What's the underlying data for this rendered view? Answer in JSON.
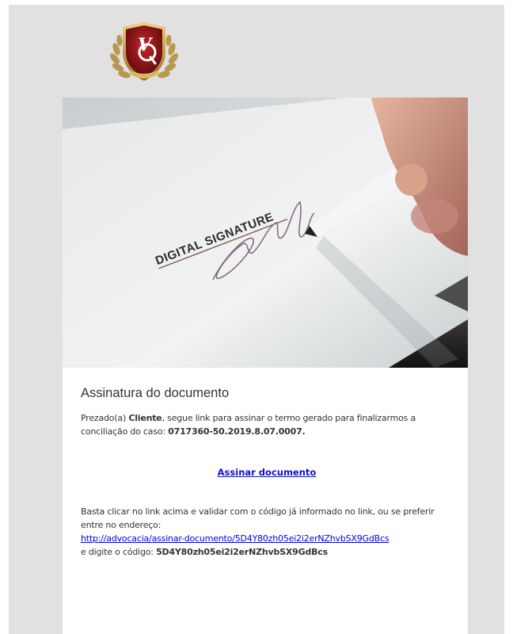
{
  "brand": {
    "logo_text": "VQ"
  },
  "hero": {
    "caption": "DIGITAL SIGNATURE"
  },
  "email": {
    "title": "Assinatura do documento",
    "greeting_prefix": "Prezado(a) ",
    "client_name": "Cliente",
    "intro_text": ", segue link para assinar o termo gerado para finalizarmos a conciliação do caso: ",
    "case_number": "0717360-50.2019.8.07.0007",
    "case_suffix": ".",
    "cta_label": "Assinar documento",
    "instructions": "Basta clicar no link acima e validar com o código já informado no link, ou se preferir entre no endereço:",
    "url_text": "http://advocacia/assinar-documento/5D4Y80zh05ei2i2erNZhvbSX9GdBcs",
    "code_prefix": "e digite o código: ",
    "code": "5D4Y80zh05ei2i2erNZhvbSX9GdBcs"
  }
}
